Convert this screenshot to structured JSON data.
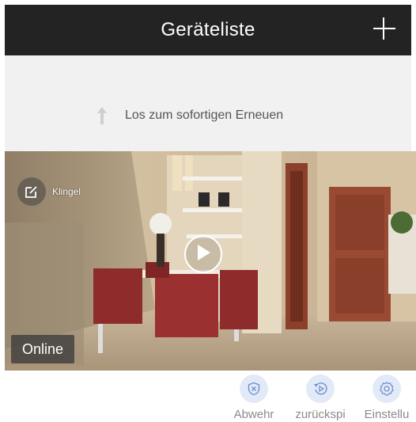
{
  "header": {
    "title": "Geräteliste",
    "add_icon": "plus-icon"
  },
  "refresh": {
    "text": "Los zum sofortigen Erneuen",
    "icon": "arrow-up-icon"
  },
  "device": {
    "name": "Klingel",
    "status": "Online",
    "edit_icon": "edit-icon",
    "play_icon": "play-icon"
  },
  "actions": [
    {
      "label": "Abwehr",
      "icon": "shield-x-icon"
    },
    {
      "label": "zurückspi",
      "icon": "playback-icon"
    },
    {
      "label": "Einstellu",
      "icon": "gear-icon"
    }
  ],
  "colors": {
    "header_bg": "#232323",
    "refresh_bg": "#f1f1f1",
    "action_icon_bg": "#e3eaf7",
    "action_icon_fg": "#6f8fd0",
    "action_label": "#8a8a8a"
  }
}
